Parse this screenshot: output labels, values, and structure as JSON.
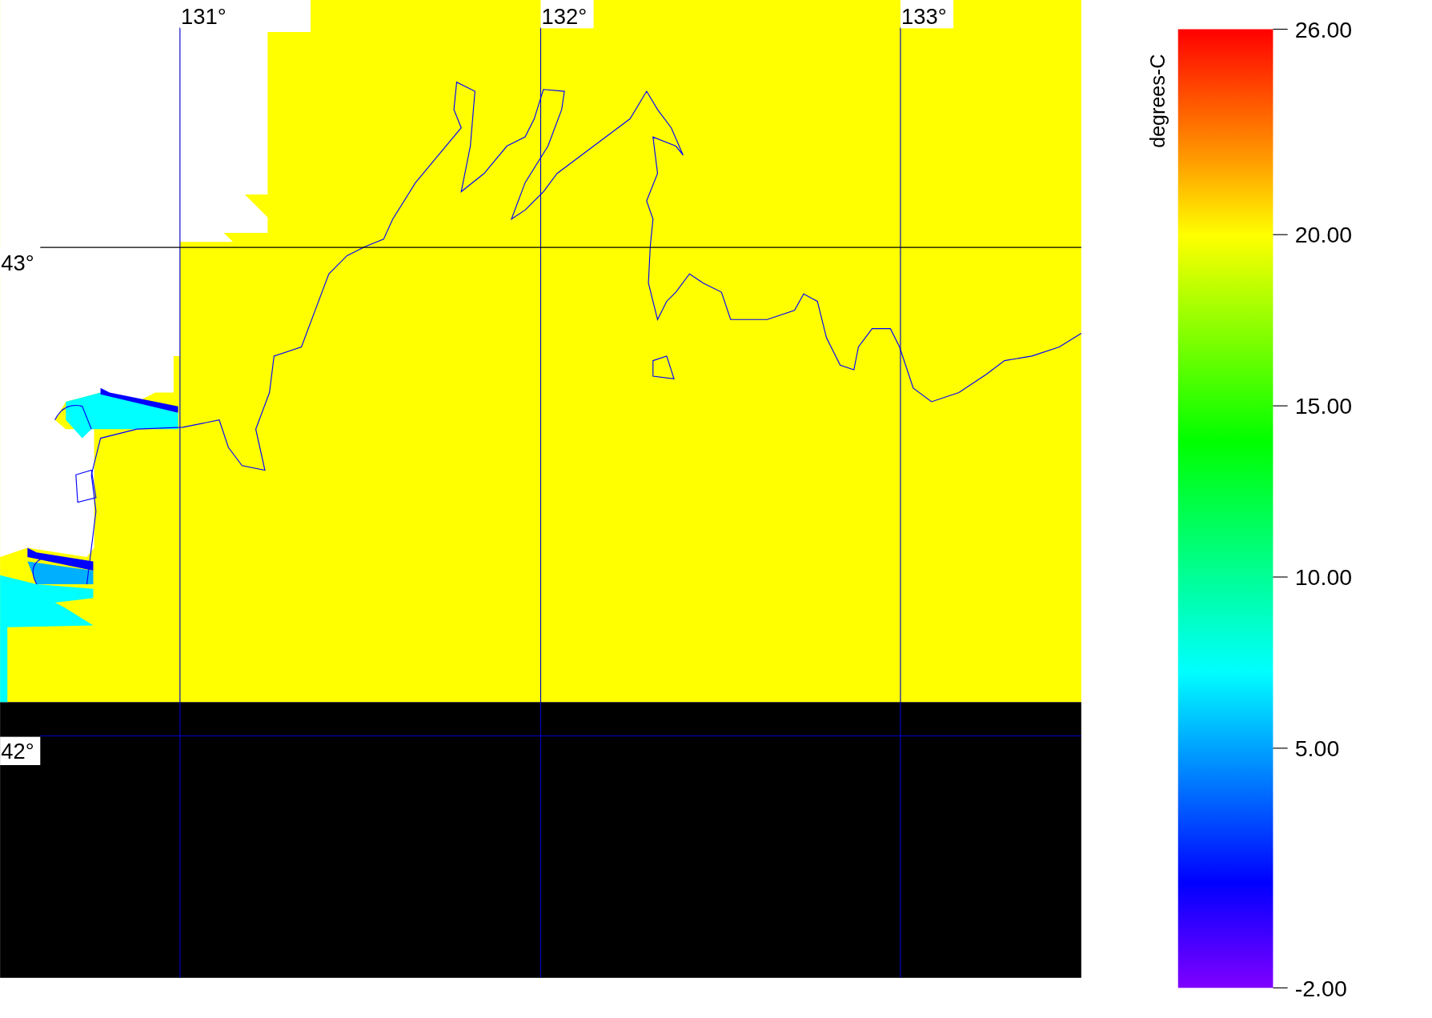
{
  "map": {
    "longitude_labels": [
      "131°",
      "132°",
      "133°"
    ],
    "latitude_labels": [
      "43°",
      "42°"
    ]
  },
  "colorbar": {
    "unit": "degrees-C",
    "tick_labels": [
      "26.00",
      "20.00",
      "15.00",
      "10.00",
      "5.00",
      "-2.00"
    ]
  }
}
